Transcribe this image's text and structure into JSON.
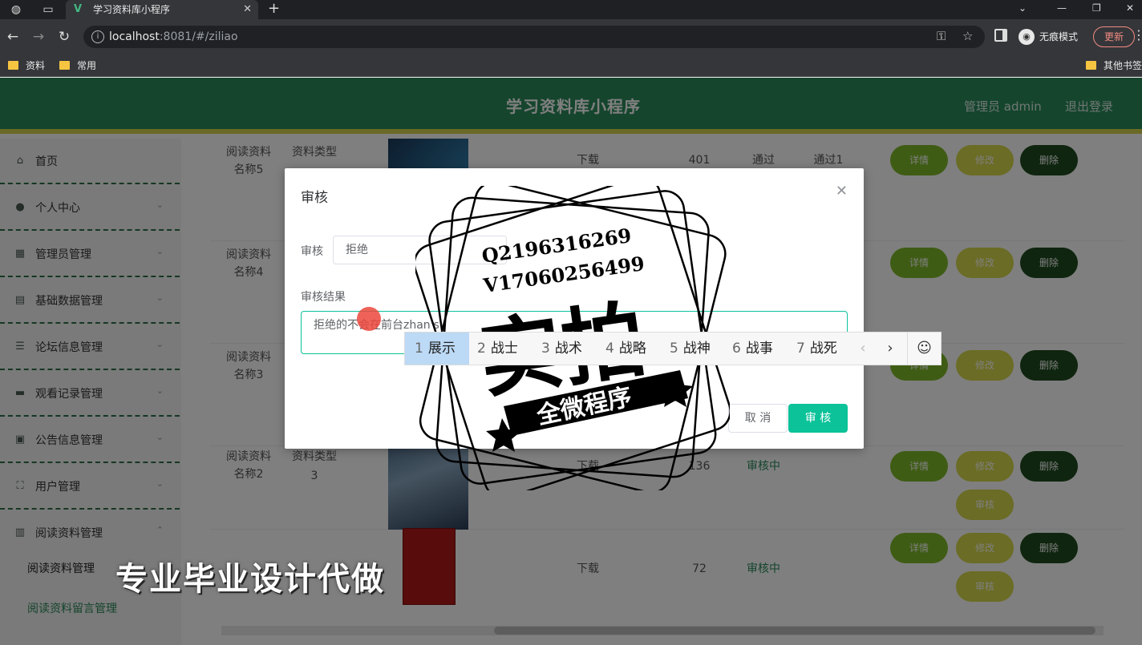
{
  "browser": {
    "tab_title": "学习资料库小程序",
    "url_host": "localhost",
    "url_rest": ":8081/#/ziliao",
    "incognito_label": "无痕模式",
    "update_label": "更新",
    "bookmarks": [
      "资料",
      "常用"
    ],
    "other_bookmarks": "其他书签"
  },
  "app": {
    "title": "学习资料库小程序",
    "admin_label": "管理员 admin",
    "logout_label": "退出登录"
  },
  "sidebar": {
    "items": [
      {
        "label": "首页",
        "icon": "home-icon"
      },
      {
        "label": "个人中心",
        "icon": "user-icon"
      },
      {
        "label": "管理员管理",
        "icon": "admin-icon"
      },
      {
        "label": "基础数据管理",
        "icon": "data-icon"
      },
      {
        "label": "论坛信息管理",
        "icon": "forum-icon"
      },
      {
        "label": "观看记录管理",
        "icon": "record-icon"
      },
      {
        "label": "公告信息管理",
        "icon": "notice-icon"
      },
      {
        "label": "用户管理",
        "icon": "users-icon"
      },
      {
        "label": "阅读资料管理",
        "icon": "book-icon"
      }
    ],
    "subitems": [
      "阅读资料管理",
      "阅读资料留言管理"
    ]
  },
  "table": {
    "rows": [
      {
        "name": "阅读资料名称5",
        "type": "资料类型",
        "type_val": "",
        "action": "下载",
        "count": "401",
        "status": "通过",
        "result": "通过1",
        "has_review": false
      },
      {
        "name": "阅读资料名称4",
        "type": "",
        "type_val": "",
        "action": "",
        "count": "",
        "status": "",
        "result": "",
        "has_review": false
      },
      {
        "name": "阅读资料名称3",
        "type": "",
        "type_val": "",
        "action": "",
        "count": "",
        "status": "",
        "result": "",
        "has_review": false
      },
      {
        "name": "阅读资料名称2",
        "type": "资料类型",
        "type_val": "3",
        "action": "下载",
        "count": "136",
        "status": "审核中",
        "result": "",
        "has_review": true
      },
      {
        "name": "",
        "type": "",
        "type_val": "",
        "action": "下载",
        "count": "72",
        "status": "审核中",
        "result": "",
        "has_review": true
      }
    ],
    "btn_detail": "详情",
    "btn_edit": "修改",
    "btn_delete": "删除",
    "btn_review": "审核"
  },
  "dialog": {
    "title": "审核",
    "review_label": "审核",
    "review_value": "拒绝",
    "result_label": "审核结果",
    "result_value": "拒绝的不会在前台zhan's",
    "cancel_label": "取 消",
    "ok_label": "审 核"
  },
  "ime": {
    "candidates": [
      {
        "num": "1",
        "text": "展示"
      },
      {
        "num": "2",
        "text": "战士"
      },
      {
        "num": "3",
        "text": "战术"
      },
      {
        "num": "4",
        "text": "战略"
      },
      {
        "num": "5",
        "text": "战神"
      },
      {
        "num": "6",
        "text": "战事"
      },
      {
        "num": "7",
        "text": "战死"
      }
    ]
  },
  "watermark": {
    "line1": "Q2196316269",
    "line2": "V17060256499",
    "main": "实拍",
    "banner": "全微程序",
    "bottom": "专业毕业设计代做"
  }
}
